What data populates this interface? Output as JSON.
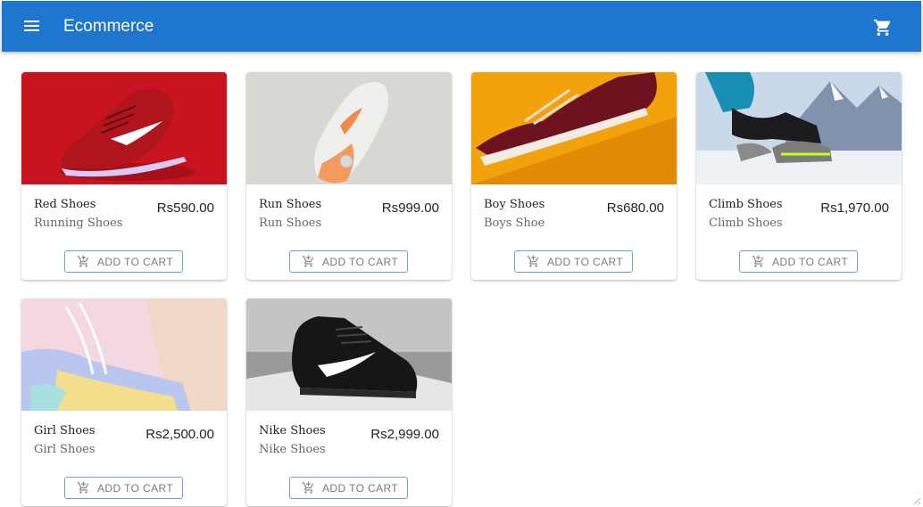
{
  "app": {
    "title": "Ecommerce"
  },
  "products": [
    {
      "name": "Red Shoes",
      "subtitle": "Running Shoes",
      "price": "Rs590.00",
      "button": "ADD TO CART"
    },
    {
      "name": "Run Shoes",
      "subtitle": "Run Shoes",
      "price": "Rs999.00",
      "button": "ADD TO CART"
    },
    {
      "name": "Boy Shoes",
      "subtitle": "Boys Shoe",
      "price": "Rs680.00",
      "button": "ADD TO CART"
    },
    {
      "name": "Climb Shoes",
      "subtitle": "Climb Shoes",
      "price": "Rs1,970.00",
      "button": "ADD TO CART"
    },
    {
      "name": "Girl Shoes",
      "subtitle": "Girl Shoes",
      "price": "Rs2,500.00",
      "button": "ADD TO CART"
    },
    {
      "name": "Nike Shoes",
      "subtitle": "Nike Shoes",
      "price": "Rs2,999.00",
      "button": "ADD TO CART"
    }
  ],
  "icons": {
    "menu": "menu-icon",
    "cart": "shopping-cart-icon",
    "add_cart": "add-shopping-cart-icon"
  },
  "colors": {
    "appbar": "#1f76cf",
    "button_border": "#6a9fd8"
  }
}
